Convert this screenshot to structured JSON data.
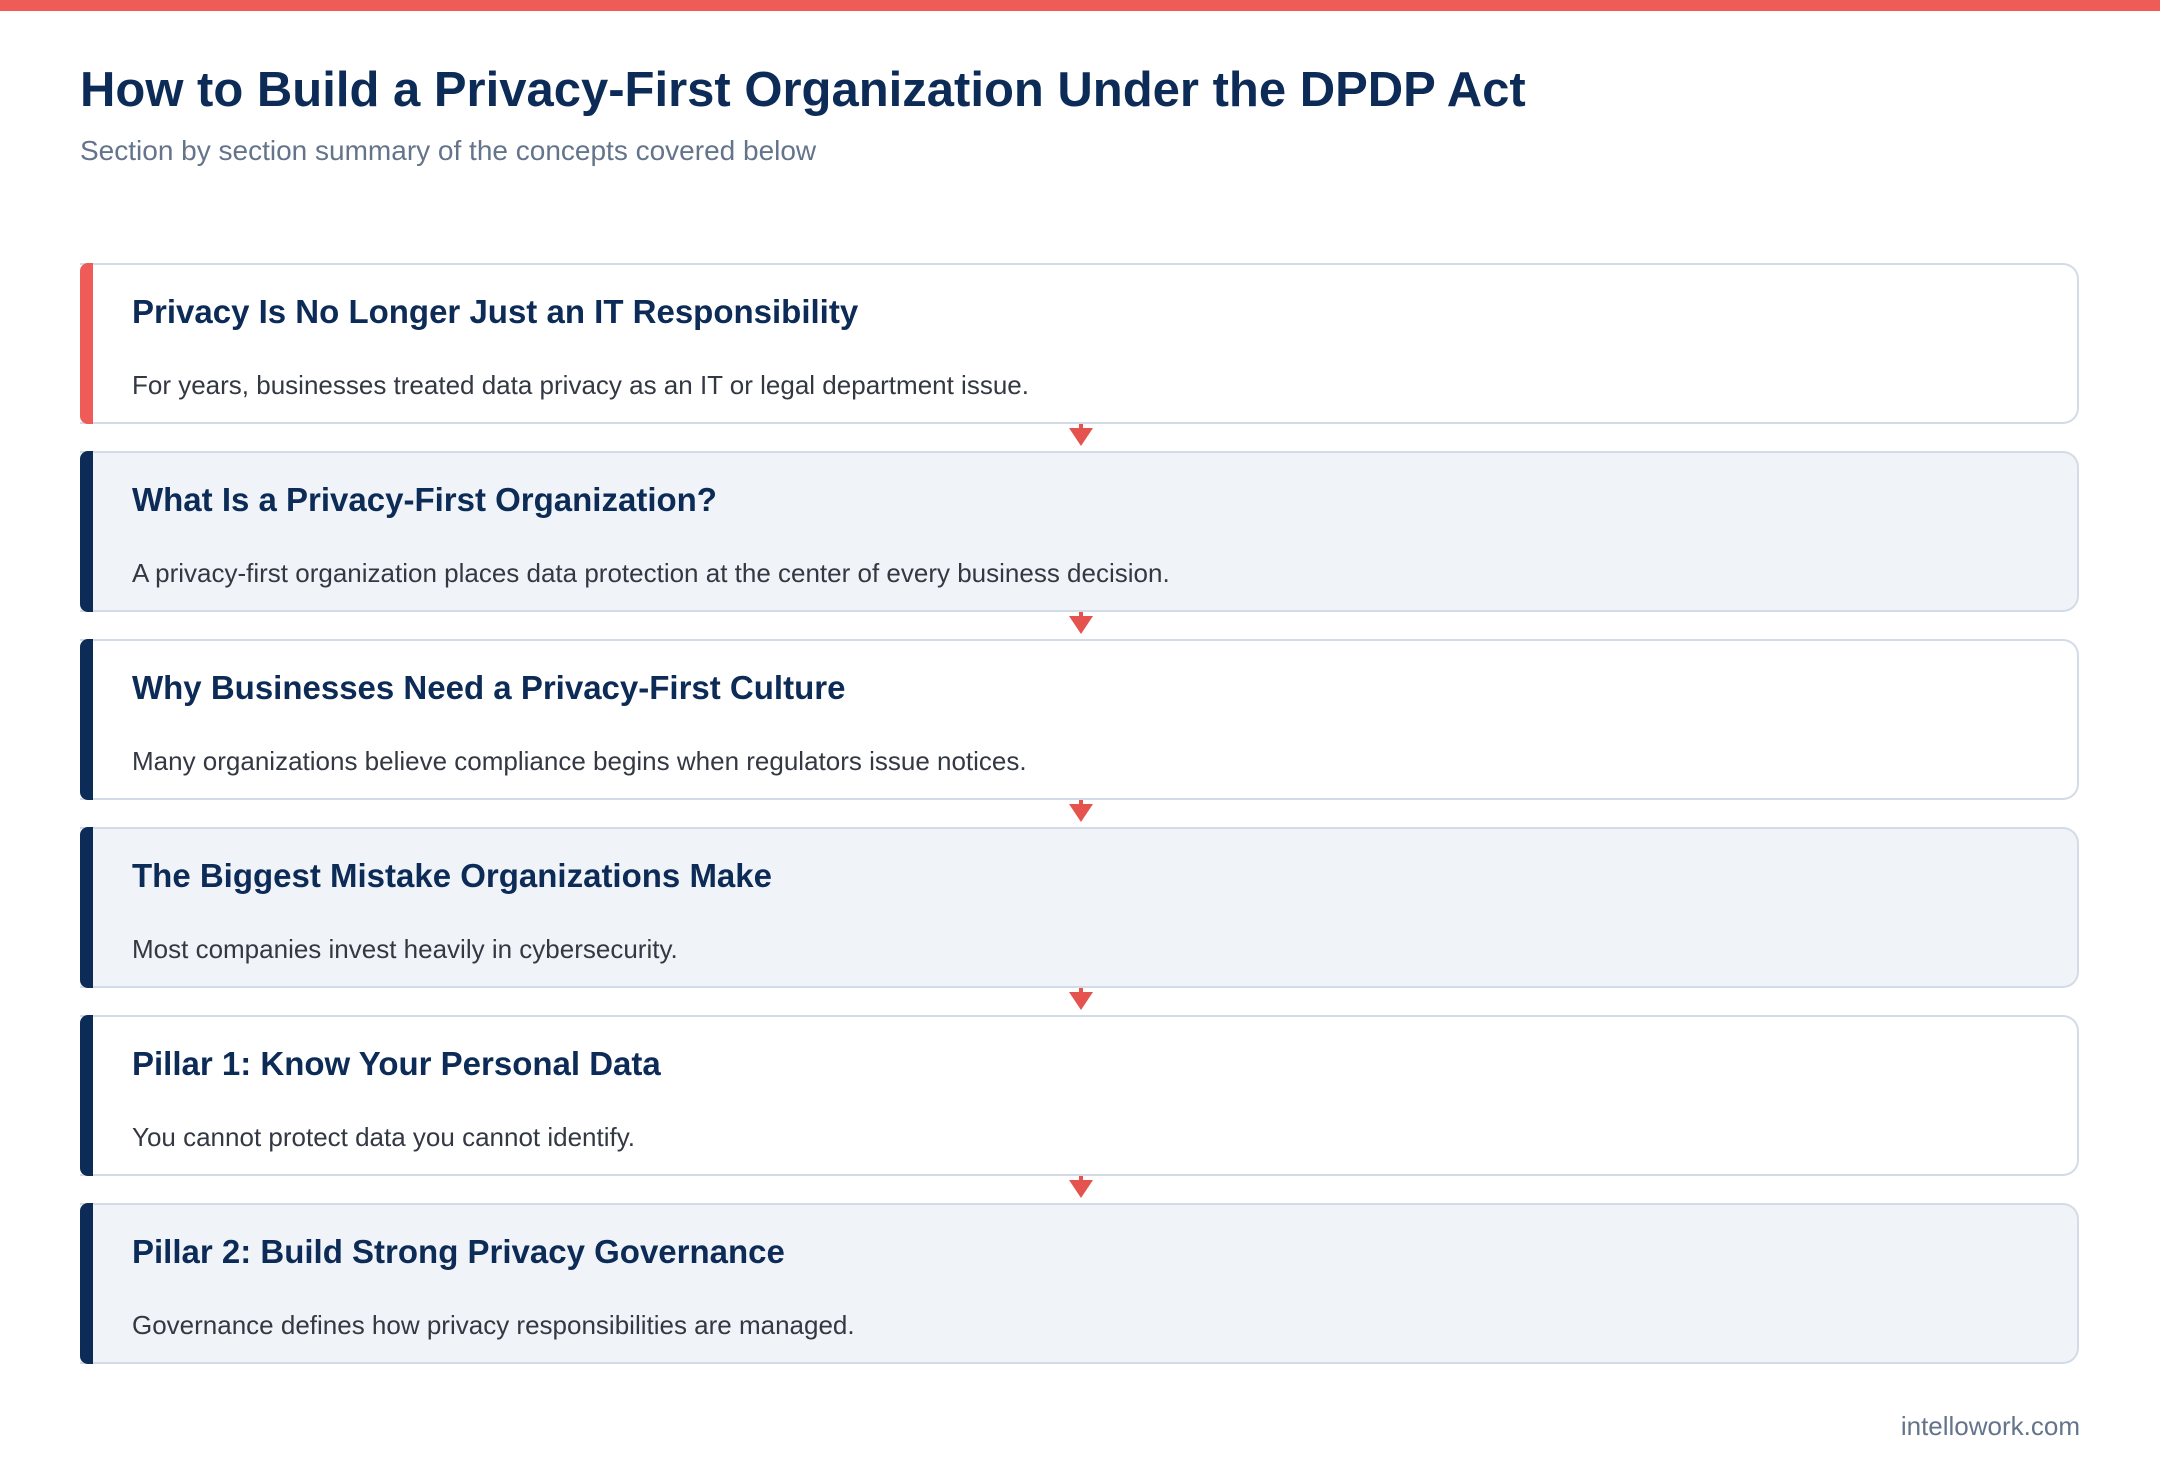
{
  "header": {
    "title": "How to Build a Privacy-First Organization Under the DPDP Act",
    "subtitle": "Section by section summary of the concepts covered below"
  },
  "sections": [
    {
      "title": "Privacy Is No Longer Just an IT Responsibility",
      "text": "For years, businesses treated data privacy as an IT or legal department issue."
    },
    {
      "title": "What Is a Privacy-First Organization?",
      "text": "A privacy-first organization places data protection at the center of every business decision."
    },
    {
      "title": "Why Businesses Need a Privacy-First Culture",
      "text": "Many organizations believe compliance begins when regulators issue notices."
    },
    {
      "title": "The Biggest Mistake Organizations Make",
      "text": "Most companies invest heavily in cybersecurity."
    },
    {
      "title": "Pillar 1: Know Your Personal Data",
      "text": "You cannot protect data you cannot identify."
    },
    {
      "title": "Pillar 2: Build Strong Privacy Governance",
      "text": "Governance defines how privacy responsibilities are managed."
    }
  ],
  "footer": {
    "site": "intellowork.com"
  },
  "colors": {
    "accent": "#ef5b57",
    "navy": "#0d2b57",
    "card_alt_bg": "#f0f4f8",
    "border": "#d3dce6"
  }
}
